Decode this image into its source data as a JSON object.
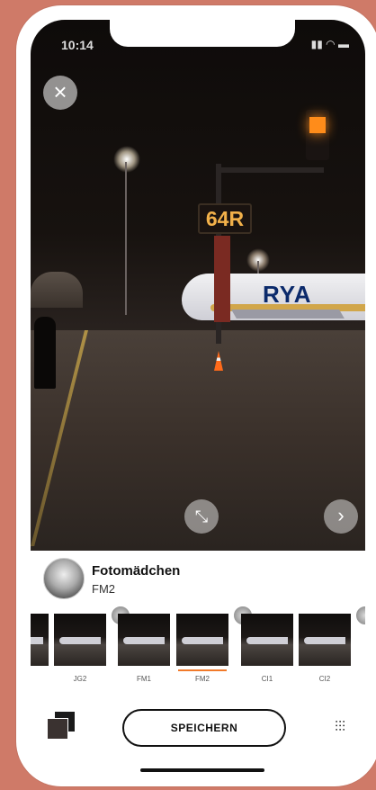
{
  "status": {
    "time": "10:14"
  },
  "photo": {
    "runway_sign": "64R",
    "plane_text": "RYA",
    "close_icon": "close-icon",
    "expand_icon": "expand-icon",
    "next_icon": "chevron-right-icon"
  },
  "profile": {
    "name": "Fotomädchen",
    "subtitle": "FM2"
  },
  "filters": [
    {
      "label": ""
    },
    {
      "label": "JG2"
    },
    {
      "label": "FM1"
    },
    {
      "label": "FM2",
      "active": true
    },
    {
      "label": "CI1"
    },
    {
      "label": "CI2"
    }
  ],
  "bottom_bar": {
    "save_label": "SPEICHERN"
  },
  "colors": {
    "accent": "#f17a2a",
    "background": "#cf7a68"
  }
}
